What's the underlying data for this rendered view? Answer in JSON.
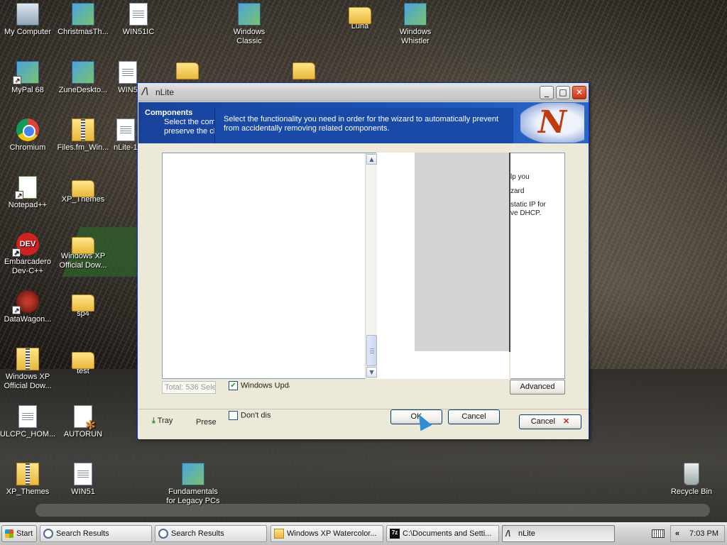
{
  "desktop": {
    "icons": [
      {
        "label": "My Computer"
      },
      {
        "label": "ChristmasTh..."
      },
      {
        "label": "WIN51IC"
      },
      {
        "label": "Windows Classic"
      },
      {
        "label": "Luna"
      },
      {
        "label": "Windows Whistler"
      },
      {
        "label": "MyPal 68"
      },
      {
        "label": "ZuneDeskto..."
      },
      {
        "label": "WIN5"
      },
      {
        "label": "Chromium"
      },
      {
        "label": "Files.fm_Win..."
      },
      {
        "label": "nLite-1"
      },
      {
        "label": "Notepad++"
      },
      {
        "label": "XP_Themes"
      },
      {
        "label": "Embarcadero Dev-C++"
      },
      {
        "label": "Windows XP Official Dow..."
      },
      {
        "label": "DataWagon..."
      },
      {
        "label": "sp4"
      },
      {
        "label": "Windows XP Official Dow..."
      },
      {
        "label": "test"
      },
      {
        "label": "ULCPC_HOM..."
      },
      {
        "label": "AUTORUN"
      },
      {
        "label": "XP_Themes"
      },
      {
        "label": "WIN51"
      },
      {
        "label": "Fundamentals for Legacy PCs"
      },
      {
        "label": "Recycle Bin"
      }
    ]
  },
  "window": {
    "title": "nLite",
    "header_title": "Components",
    "header_sub_line1": "Select the comp",
    "header_sub_line2": "preserve the ch",
    "tooltip_line1": "Select the functionality you need in order for the wizard to automatically prevent",
    "tooltip_line2": "from accidentally removing related components.",
    "desc_lines": [
      "lp you",
      "zard",
      "static IP for",
      "ve DHCP."
    ],
    "total_text": "Total: 536 Sele",
    "windows_update_label": "Windows Upda",
    "dont_display_label": "Don't disp",
    "advanced_label": "Advanced",
    "tray_label": "Tray",
    "presets_label": "Prese",
    "ok_label": "OK",
    "cancel_inner_label": "Cancel",
    "cancel_label": "Cancel"
  },
  "taskbar": {
    "start_label": "Start",
    "tasks": [
      {
        "label": "Search Results"
      },
      {
        "label": "Search Results"
      },
      {
        "label": "Windows XP Watercolor..."
      },
      {
        "label": "C:\\Documents and Setti..."
      },
      {
        "label": "nLite"
      }
    ],
    "clock": "7:03 PM"
  },
  "colors": {
    "header_blue": "#1c54b8",
    "close_red": "#c53315"
  }
}
